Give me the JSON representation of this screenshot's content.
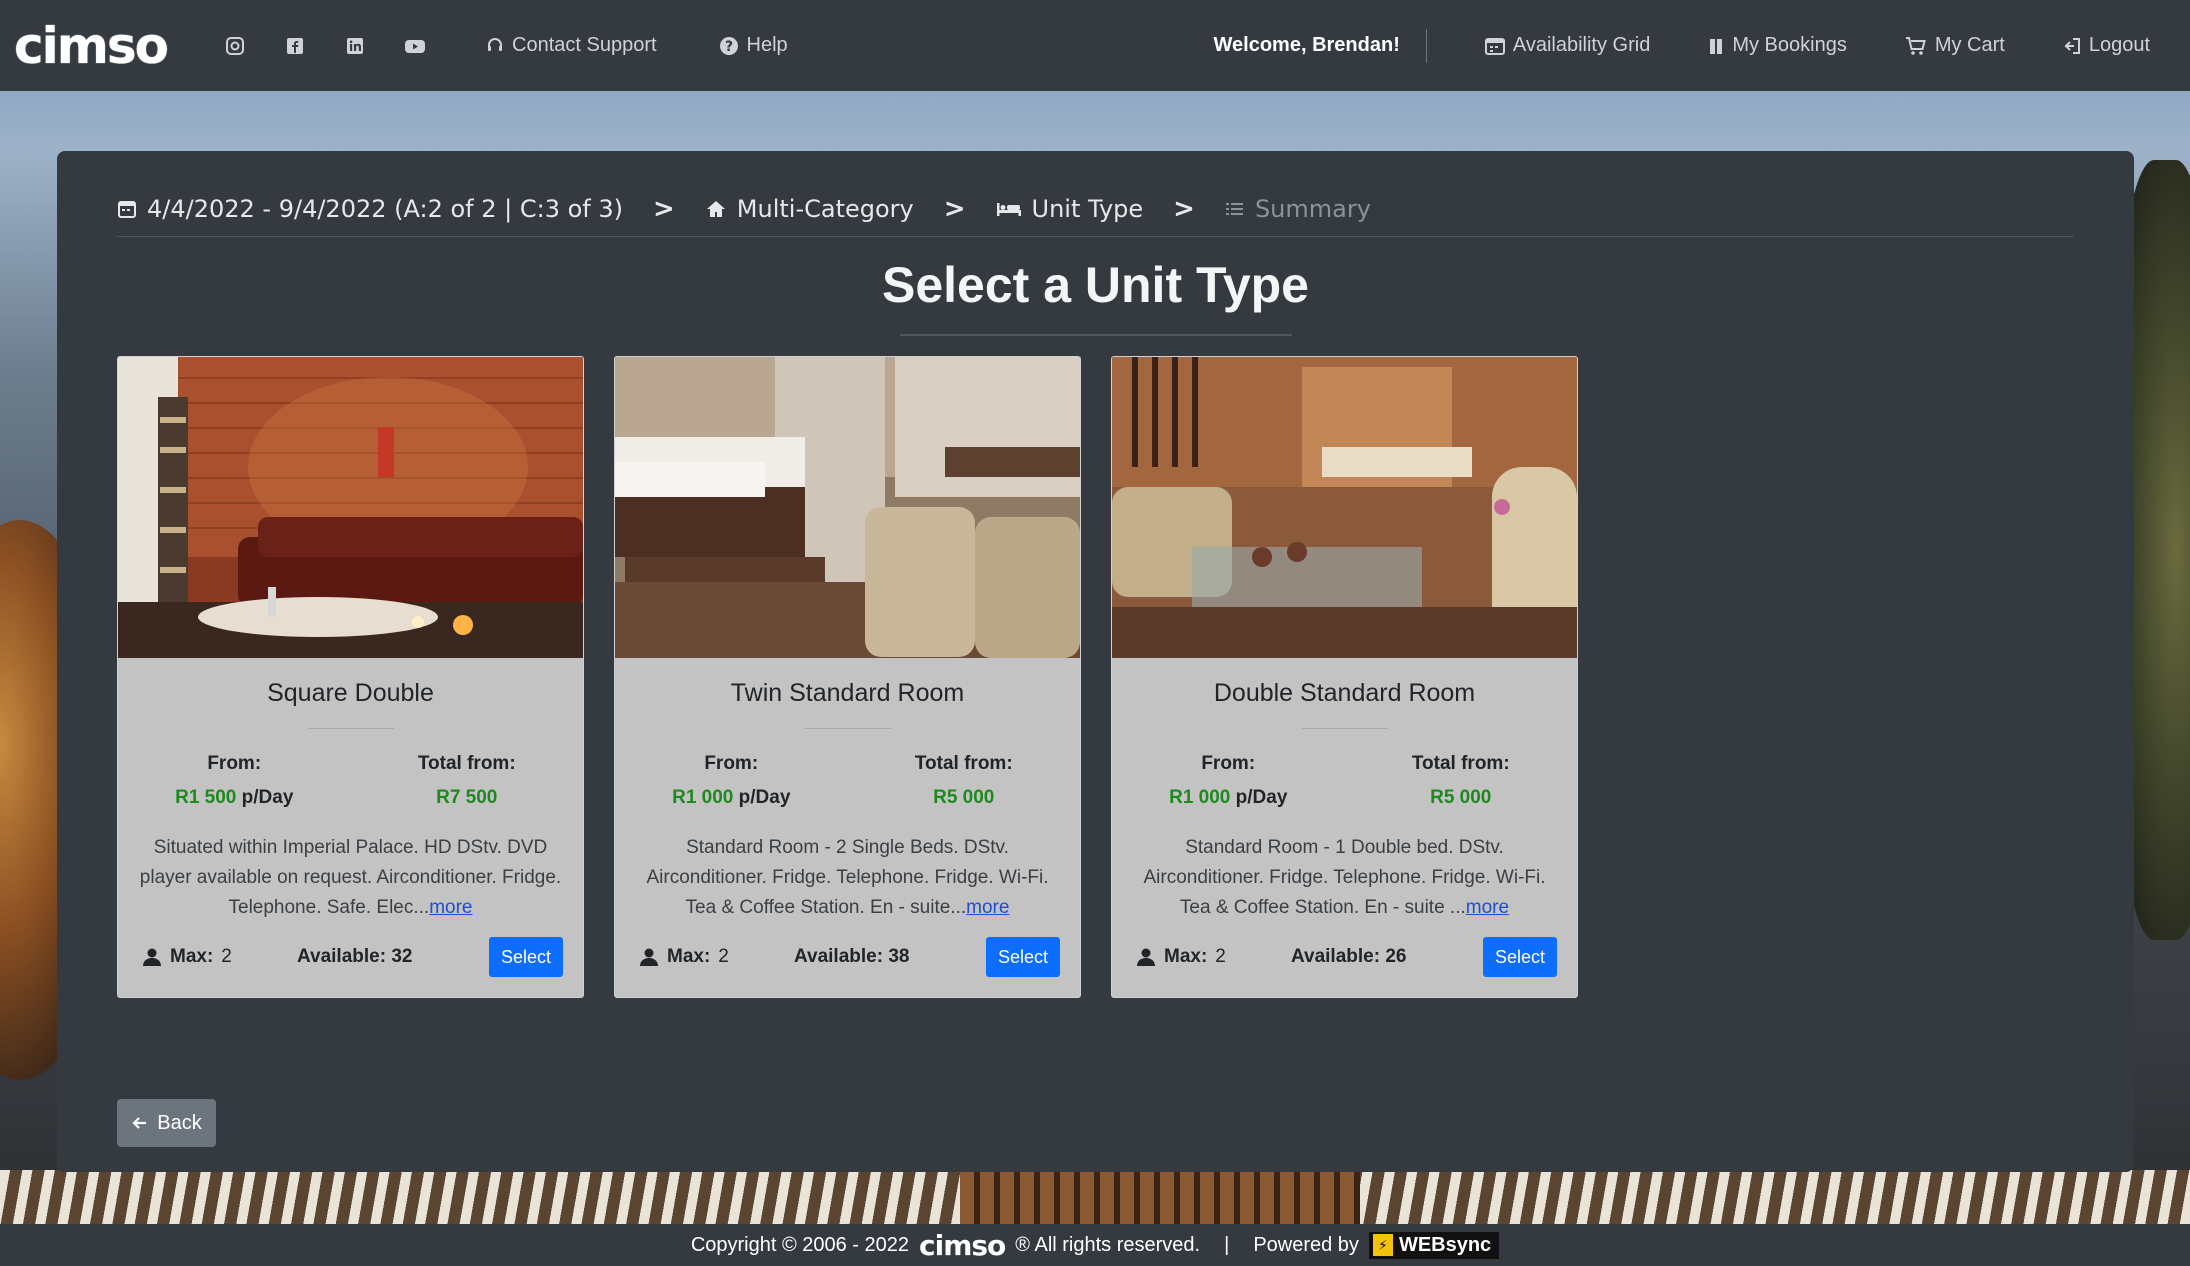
{
  "nav": {
    "logo": "CIMSO",
    "social": [
      "instagram-icon",
      "facebook-icon",
      "linkedin-icon",
      "youtube-icon"
    ],
    "contact_support": "Contact Support",
    "help": "Help",
    "welcome": "Welcome, Brendan!",
    "availability_grid": "Availability Grid",
    "my_bookings": "My Bookings",
    "my_cart": "My Cart",
    "logout": "Logout"
  },
  "breadcrumb": {
    "dates": "4/4/2022 - 9/4/2022 (A:2 of 2 | C:3 of 3)",
    "sep": ">",
    "multi_category": "Multi-Category",
    "unit_type": "Unit Type",
    "summary": "Summary"
  },
  "page_title": "Select a Unit Type",
  "cards": [
    {
      "name": "Square Double",
      "from_label": "From:",
      "total_label": "Total from:",
      "from_price": "R1 500",
      "per_day": "p/Day",
      "total_price": "R7 500",
      "description": "Situated within Imperial Palace. HD DStv. DVD player available on request. Airconditioner. Fridge. Telephone. Safe. Elec...",
      "more": "more",
      "max_label": "Max:",
      "max_value": "2",
      "available": "Available: 32",
      "select": "Select"
    },
    {
      "name": "Twin Standard Room",
      "from_label": "From:",
      "total_label": "Total from:",
      "from_price": "R1 000",
      "per_day": "p/Day",
      "total_price": "R5 000",
      "description": "Standard Room - 2 Single Beds. DStv. Airconditioner. Fridge. Telephone. Fridge. Wi-Fi. Tea & Coffee Station. En - suite...",
      "more": "more",
      "max_label": "Max:",
      "max_value": "2",
      "available": "Available: 38",
      "select": "Select"
    },
    {
      "name": "Double Standard Room",
      "from_label": "From:",
      "total_label": "Total from:",
      "from_price": "R1 000",
      "per_day": "p/Day",
      "total_price": "R5 000",
      "description": "Standard Room - 1 Double bed. DStv. Airconditioner. Fridge. Telephone. Fridge. Wi-Fi. Tea & Coffee Station. En - suite ...",
      "more": "more",
      "max_label": "Max:",
      "max_value": "2",
      "available": "Available: 26",
      "select": "Select"
    }
  ],
  "back": "Back",
  "footer": {
    "copyright": "Copyright © 2006 - 2022",
    "logo": "CIMSO",
    "rights": "® All rights reserved.",
    "separator": "|",
    "powered_by": "Powered by",
    "websync": "WEBsync"
  },
  "colors": {
    "nav_bg": "#343a40",
    "card_bg": "#c3c3c3",
    "price_green": "#1e8a1e",
    "select_blue": "#0d6efd",
    "back_gray": "#6c757d"
  }
}
